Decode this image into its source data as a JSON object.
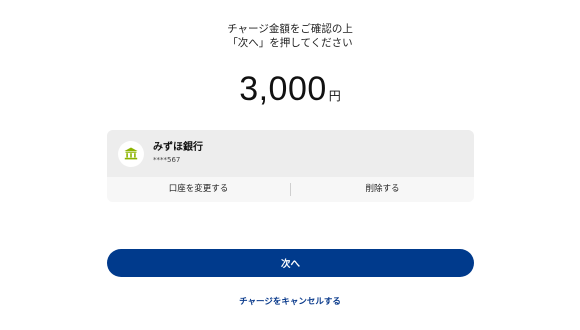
{
  "instruction": {
    "line1": "チャージ金額をご確認の上",
    "line2": "「次へ」を押してください"
  },
  "amount": {
    "value": "3,000",
    "unit": "円"
  },
  "bank": {
    "name": "みずほ銀行",
    "account": "****567",
    "logo_icon": "bank-building-icon",
    "logo_color": "#8cb400",
    "change_label": "口座を変更する",
    "delete_label": "削除する"
  },
  "actions": {
    "next_label": "次へ",
    "cancel_label": "チャージをキャンセルする"
  },
  "colors": {
    "primary": "#003a8c",
    "link": "#0b3b8c"
  }
}
